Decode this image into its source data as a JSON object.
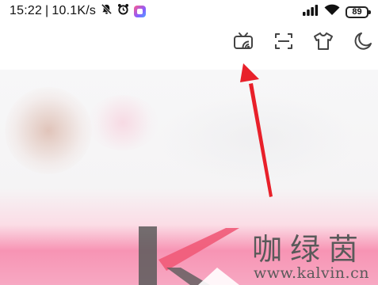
{
  "status_bar": {
    "time": "15:22",
    "separator": "|",
    "network_speed": "10.1K/s",
    "left_icons": [
      "bell-muted-icon",
      "alarm-clock-icon",
      "app-notification-icon"
    ],
    "right_icons": [
      "cellular-signal-icon",
      "wifi-icon",
      "battery-icon"
    ],
    "battery_level": "89"
  },
  "toolbar": {
    "icons": [
      "cast-tv-icon",
      "scan-icon",
      "tshirt-icon",
      "moon-icon"
    ],
    "accent_color": "#555555"
  },
  "annotation": {
    "type": "red arrow pointing to cast-tv-icon",
    "color": "#e8202a"
  },
  "watermark": {
    "title": "咖绿茵",
    "url": "www.kalvin.cn",
    "logo": "kalvin-logo"
  }
}
